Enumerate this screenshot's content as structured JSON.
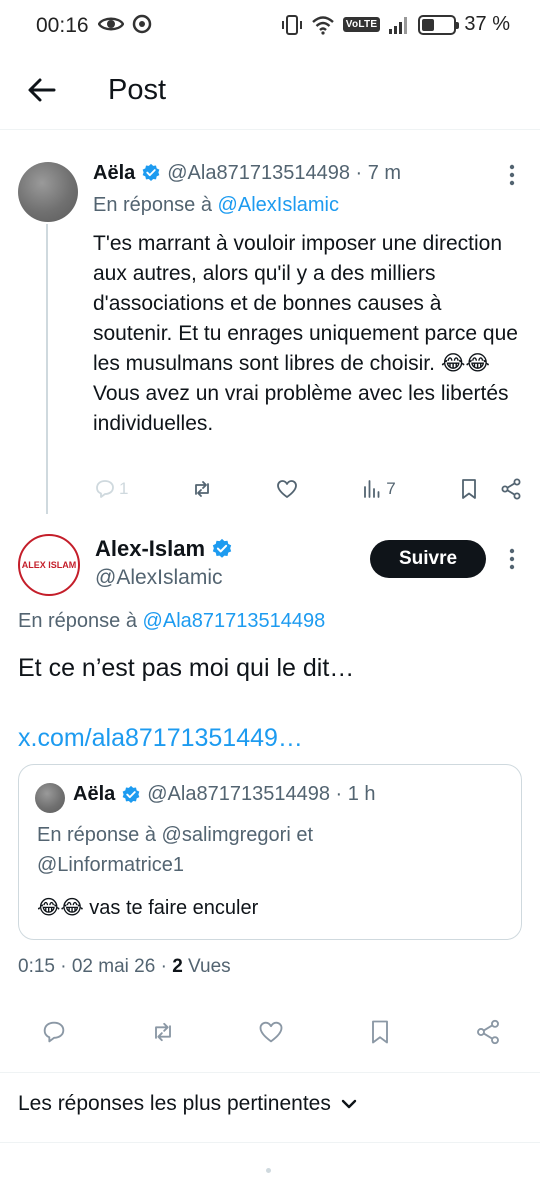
{
  "status_bar": {
    "time": "00:16",
    "volte": "VoLTE",
    "battery_percent": "37 %",
    "battery_level": 0.37
  },
  "header": {
    "title": "Post"
  },
  "reply_tweet": {
    "author_name": "Aëla",
    "handle_time": "@Ala871713514498 · 7 m",
    "reply_prefix": "En réponse à",
    "reply_target": "@AlexIslamic",
    "text": "T'es marrant à vouloir imposer une direction aux autres, alors qu'il y a des milliers d'associations et de bonnes causes à soutenir. Et tu enrages uniquement parce que les musulmans sont libres de choisir. 😂😂 Vous avez un vrai problème avec les libertés individuelles.",
    "reply_count": "1",
    "view_count": "7"
  },
  "main_tweet": {
    "author_name": "Alex-Islam",
    "handle": "@AlexIslamic",
    "avatar_text": "ALEX ISLAM",
    "follow_label": "Suivre",
    "reply_prefix": "En réponse à",
    "reply_target": "@Ala871713514498",
    "text": "Et ce n’est pas moi qui le dit…",
    "link": "x.com/ala87171351449…",
    "quote": {
      "author_name": "Aëla",
      "handle_time": "@Ala871713514498 · 1 h",
      "reply_line1": "En réponse à @salimgregori et",
      "reply_line2": "@Linformatrice1",
      "text": "😂😂 vas te faire enculer"
    },
    "meta_prefix": "0:15 · 02 mai 26 · ",
    "views_count": "2",
    "views_label": " Vues"
  },
  "replies_sort": {
    "label": "Les réponses les plus pertinentes"
  },
  "colors": {
    "accent": "#1d9bf0",
    "text": "#0f1419",
    "secondary": "#536471",
    "border": "#cfd9de"
  }
}
